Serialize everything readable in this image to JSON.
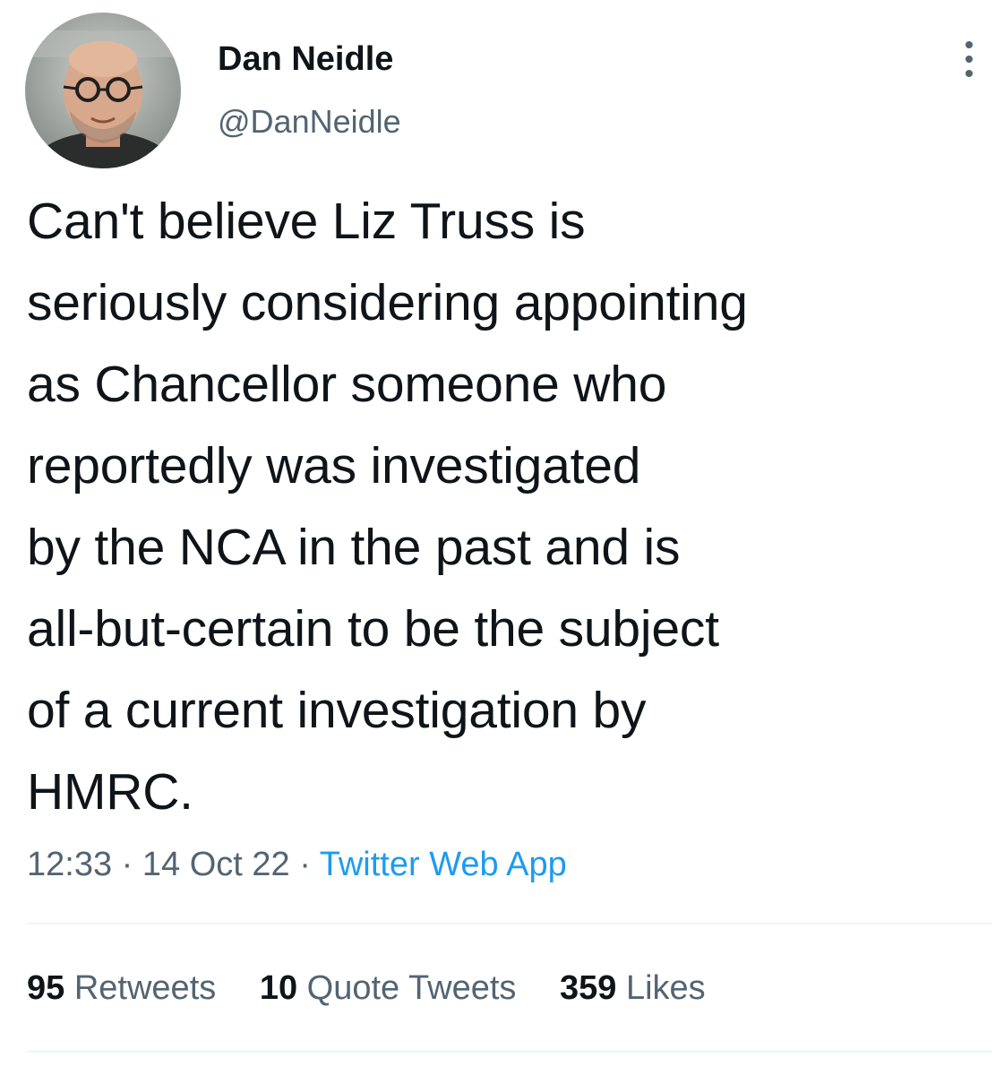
{
  "author": {
    "display_name": "Dan Neidle",
    "handle": "@DanNeidle",
    "avatar_icon": "profile-photo"
  },
  "menu": {
    "icon": "more-options-icon"
  },
  "tweet": {
    "text": "Can't believe Liz Truss is\nseriously considering appointing\nas Chancellor someone who\nreportedly was investigated\nby the NCA in the past and is\nall-but-certain to be the subject\nof a current investigation by\nHMRC."
  },
  "meta": {
    "time": "12:33",
    "separator": "·",
    "date": "14 Oct 22",
    "source": "Twitter Web App"
  },
  "stats": {
    "retweets": {
      "count": "95",
      "label": "Retweets"
    },
    "quotes": {
      "count": "10",
      "label": "Quote Tweets"
    },
    "likes": {
      "count": "359",
      "label": "Likes"
    }
  },
  "colors": {
    "text": "#0f1419",
    "secondary": "#536471",
    "link": "#1d9bf0",
    "divider": "#eff3f4"
  }
}
